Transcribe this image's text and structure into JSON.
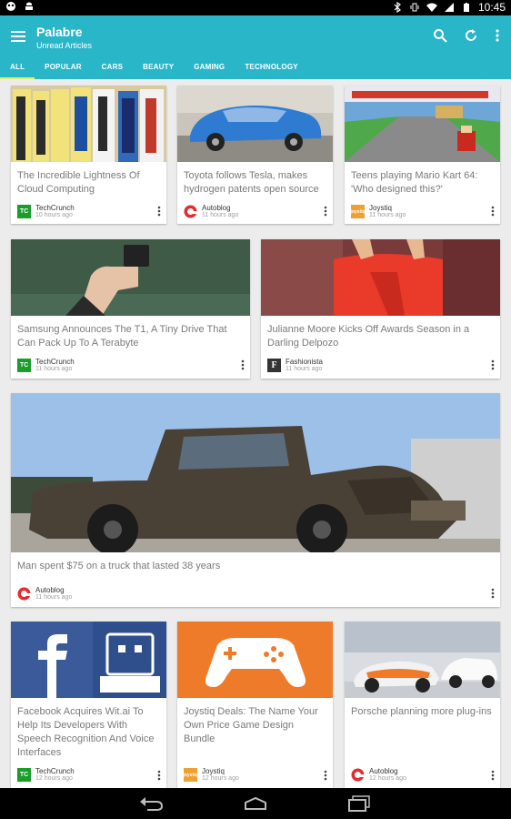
{
  "status": {
    "time": "10:45"
  },
  "appbar": {
    "title": "Palabre",
    "subtitle": "Unread Articles"
  },
  "tabs": [
    "ALL",
    "POPULAR",
    "CARS",
    "BEAUTY",
    "GAMING",
    "TECHNOLOGY"
  ],
  "articles": [
    {
      "title": "The Incredible Lightness Of Cloud Computing",
      "source": "TechCrunch",
      "time": "10 hours ago",
      "logo_text": "TC"
    },
    {
      "title": "Toyota follows Tesla, makes hydrogen patents open source",
      "source": "Autoblog",
      "time": "11 hours ago",
      "logo_text": ""
    },
    {
      "title": "Teens playing Mario Kart 64: 'Who designed this?'",
      "source": "Joystiq",
      "time": "11 hours ago",
      "logo_text": "joystiq"
    },
    {
      "title": "Samsung Announces The T1, A Tiny Drive That Can Pack Up To A Terabyte",
      "source": "TechCrunch",
      "time": "11 hours ago",
      "logo_text": "TC"
    },
    {
      "title": "Julianne Moore Kicks Off Awards Season in a Darling Delpozo",
      "source": "Fashionista",
      "time": "11 hours ago",
      "logo_text": "F"
    },
    {
      "title": "Man spent $75 on a truck that lasted 38 years",
      "source": "Autoblog",
      "time": "11 hours ago",
      "logo_text": ""
    },
    {
      "title": "Facebook Acquires Wit.ai To Help Its Developers With Speech Recognition And Voice Interfaces",
      "source": "TechCrunch",
      "time": "12 hours ago",
      "logo_text": "TC"
    },
    {
      "title": "Joystiq Deals: The Name Your Own Price Game Design Bundle",
      "source": "Joystiq",
      "time": "12 hours ago",
      "logo_text": "joystiq"
    },
    {
      "title": "Porsche planning more plug-ins",
      "source": "Autoblog",
      "time": "12 hours ago",
      "logo_text": ""
    }
  ],
  "colors": {
    "accent": "#29b6c8",
    "tab_indicator": "#e6ee66",
    "techcrunch": "#1a9e2a",
    "autoblog": "#e52b2b",
    "joystiq": "#f0a030"
  }
}
